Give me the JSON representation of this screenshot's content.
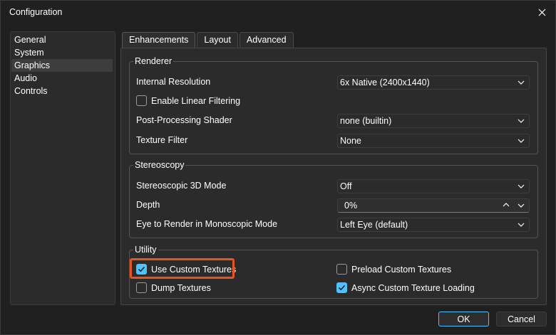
{
  "window": {
    "title": "Configuration"
  },
  "sidebar": {
    "items": [
      {
        "label": "General"
      },
      {
        "label": "System"
      },
      {
        "label": "Graphics"
      },
      {
        "label": "Audio"
      },
      {
        "label": "Controls"
      }
    ],
    "selected": "Graphics"
  },
  "tabs": [
    {
      "label": "Enhancements"
    },
    {
      "label": "Layout"
    },
    {
      "label": "Advanced"
    }
  ],
  "renderer": {
    "title": "Renderer",
    "internal_resolution_label": "Internal Resolution",
    "internal_resolution_value": "6x Native (2400x1440)",
    "linear_filtering_label": "Enable Linear Filtering",
    "linear_filtering_checked": false,
    "post_processing_label": "Post-Processing Shader",
    "post_processing_value": "none (builtin)",
    "texture_filter_label": "Texture Filter",
    "texture_filter_value": "None"
  },
  "stereoscopy": {
    "title": "Stereoscopy",
    "mode_label": "Stereoscopic 3D Mode",
    "mode_value": "Off",
    "depth_label": "Depth",
    "depth_value": "0%",
    "eye_label": "Eye to Render in Monoscopic Mode",
    "eye_value": "Left Eye (default)"
  },
  "utility": {
    "title": "Utility",
    "use_custom_textures_label": "Use Custom Textures",
    "use_custom_textures_checked": true,
    "preload_custom_textures_label": "Preload Custom Textures",
    "preload_custom_textures_checked": false,
    "dump_textures_label": "Dump Textures",
    "dump_textures_checked": false,
    "async_loading_label": "Async Custom Texture Loading",
    "async_loading_checked": true
  },
  "buttons": {
    "ok": "OK",
    "cancel": "Cancel"
  },
  "colors": {
    "accent": "#4cc2ff",
    "highlight": "#e8541f",
    "background": "#202020",
    "panel": "#2b2b2b"
  }
}
